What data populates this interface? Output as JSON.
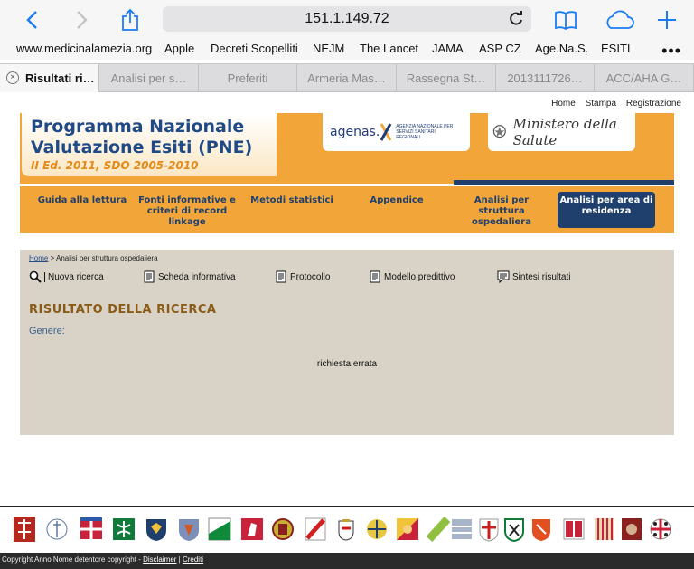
{
  "browser": {
    "url": "151.1.149.72",
    "bookmarks": [
      "www.medicinalamezia.org",
      "Apple",
      "Decreti Scopelliti",
      "NEJM",
      "The Lancet",
      "JAMA",
      "ASP CZ",
      "Age.Na.S.",
      "ESITI"
    ],
    "more_label": "•••",
    "tabs": [
      "Risultati ri…",
      "Analisi per s…",
      "Preferiti",
      "Armeria Mas…",
      "Rassegna St…",
      "2013111726…",
      "ACC/AHA G…"
    ],
    "close_glyph": "×"
  },
  "page": {
    "topnav": [
      "Home",
      "Stampa",
      "Registrazione"
    ],
    "title_line1": "Programma Nazionale",
    "title_line2": "Valutazione Esiti (PNE)",
    "subtitle": "II Ed. 2011, SDO 2005-2010",
    "agenas_logo": "agenas.",
    "agenas_sub": "AGENZIA NAZIONALE PER I SERVIZI SANITARI REGIONALI",
    "ministero_logo": "Ministero della Salute",
    "menu": [
      "Guida alla lettura",
      "Fonti informative e criteri di record linkage",
      "Metodi statistici",
      "Appendice",
      "Analisi per struttura ospedaliera",
      "Analisi per area di residenza"
    ],
    "breadcrumb_home": "Home",
    "breadcrumb_rest": " > Analisi per struttura ospedaliera",
    "actions": [
      "Nuova ricerca",
      "Scheda informativa",
      "Protocollo",
      "Modello predittivo",
      "Sintesi risultati"
    ],
    "result_title": "RISULTATO DELLA RICERCA",
    "genere_label": "Genere:",
    "error_message": "richiesta errata",
    "copyright_prefix": "Copyright Anno Nome detentore copyright - ",
    "disclaimer": "Disclaimer",
    "separator": " | ",
    "crediti": "Crediti"
  },
  "colors": {
    "banner": "#f2a63a",
    "navy": "#1f3f6d",
    "content_bg": "#d9d3c7",
    "title_blue": "#1f4a86"
  }
}
